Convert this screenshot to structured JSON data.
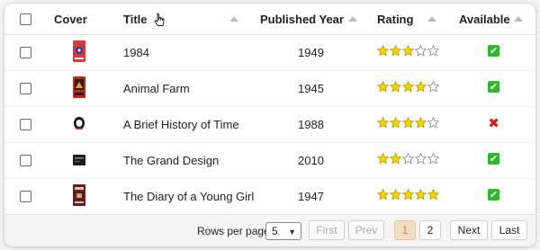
{
  "columns": [
    {
      "label": "",
      "kind": "select-all"
    },
    {
      "label": "Cover"
    },
    {
      "label": "Title"
    },
    {
      "label": "Published Year"
    },
    {
      "label": "Rating"
    },
    {
      "label": "Available"
    }
  ],
  "rows": [
    {
      "title": "1984",
      "year": "1949",
      "rating": 3,
      "available": true,
      "cover_color": "#d83a3a",
      "cover_accent": "#4a2a8a"
    },
    {
      "title": "Animal Farm",
      "year": "1945",
      "rating": 4,
      "available": true,
      "cover_color": "#c02c1e",
      "cover_accent": "#3a1a12"
    },
    {
      "title": "A Brief History of Time",
      "year": "1988",
      "rating": 4,
      "available": false,
      "cover_color": "#ffffff",
      "cover_accent": "#111111"
    },
    {
      "title": "The Grand Design",
      "year": "2010",
      "rating": 2,
      "available": true,
      "cover_color": "#1b1b1b",
      "cover_accent": "#777777"
    },
    {
      "title": "The Diary of a Young Girl",
      "year": "1947",
      "rating": 5,
      "available": true,
      "cover_color": "#6b1b1b",
      "cover_accent": "#d9c7a8"
    }
  ],
  "pagination": {
    "rows_per_page_label": "Rows per page",
    "rows_per_page_value": "5",
    "first_label": "First",
    "prev_label": "Prev",
    "pages": [
      "1",
      "2"
    ],
    "active_page": "1",
    "next_label": "Next",
    "last_label": "Last"
  },
  "colors": {
    "star_filled": "#f2d600",
    "star_empty": "#ffffff",
    "available_yes": "#2eb82e",
    "available_no": "#d32020",
    "active_page_bg": "#f1dcc4"
  }
}
